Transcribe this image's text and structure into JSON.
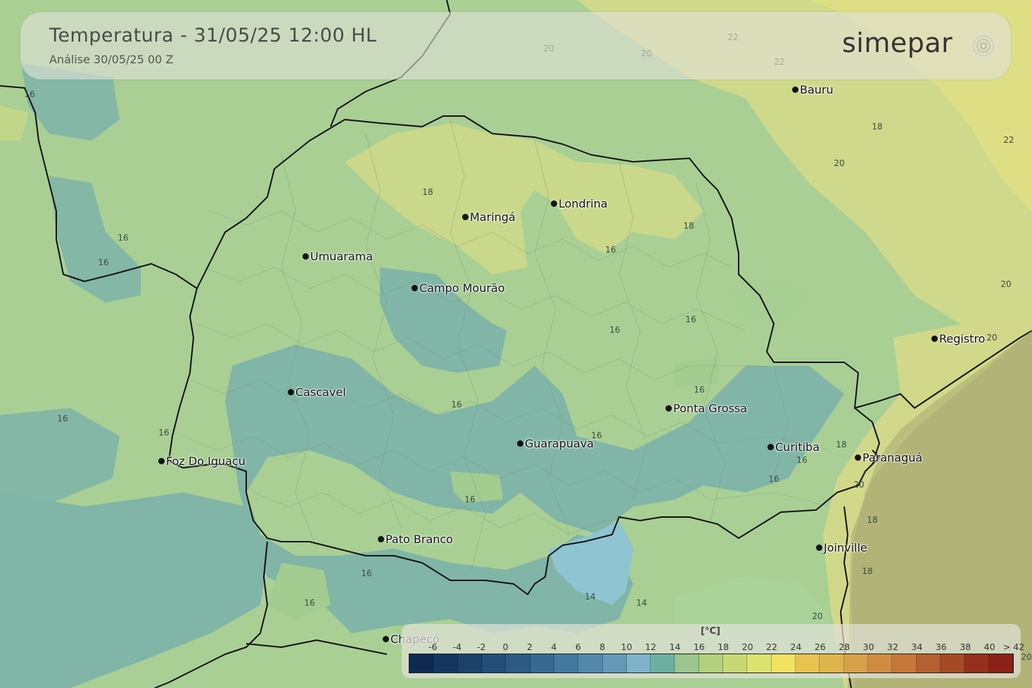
{
  "header": {
    "title": "Temperatura - 31/05/25 12:00 HL",
    "subtitle": "Análise 30/05/25 00 Z"
  },
  "brand": {
    "name": "simepar",
    "icon": "radar-waves-icon"
  },
  "cities": [
    {
      "name": "Bauru"
    },
    {
      "name": "Londrina"
    },
    {
      "name": "Maringá"
    },
    {
      "name": "Umuarama"
    },
    {
      "name": "Campo Mourão"
    },
    {
      "name": "Registro"
    },
    {
      "name": "Cascavel"
    },
    {
      "name": "Ponta Grossa"
    },
    {
      "name": "Guarapuava"
    },
    {
      "name": "Curitiba"
    },
    {
      "name": "Foz Do Iguaçu"
    },
    {
      "name": "Paranaguá"
    },
    {
      "name": "Pato Branco"
    },
    {
      "name": "Joinville"
    },
    {
      "name": "Chapecó"
    }
  ],
  "contour_labels": [
    "16",
    "16",
    "16",
    "18",
    "16",
    "18",
    "16",
    "16",
    "16",
    "16",
    "16",
    "16",
    "16",
    "16",
    "14",
    "14",
    "16",
    "16",
    "16",
    "18",
    "20",
    "18",
    "22",
    "20",
    "20",
    "20",
    "22",
    "22",
    "20",
    "20",
    "16",
    "18",
    "18",
    "20",
    "20"
  ],
  "legend": {
    "unit": "[°C]",
    "ticks": [
      "-6",
      "-4",
      "-2",
      "0",
      "2",
      "4",
      "6",
      "8",
      "10",
      "12",
      "14",
      "16",
      "18",
      "20",
      "22",
      "24",
      "26",
      "28",
      "30",
      "32",
      "34",
      "36",
      "38",
      "40",
      "> 42"
    ],
    "colors": [
      "#0e2a52",
      "#14365f",
      "#1a426b",
      "#244e78",
      "#2c5b85",
      "#366a92",
      "#43799f",
      "#5188ac",
      "#6499b7",
      "#7fb3c9",
      "#6cb0a3",
      "#99c68c",
      "#b1d17f",
      "#c7d875",
      "#dde170",
      "#f1e262",
      "#e8c350",
      "#dfb44c",
      "#d7a04a",
      "#cf8d42",
      "#c6773a",
      "#b46030",
      "#a44b26",
      "#962f1c",
      "#8c2217"
    ]
  }
}
